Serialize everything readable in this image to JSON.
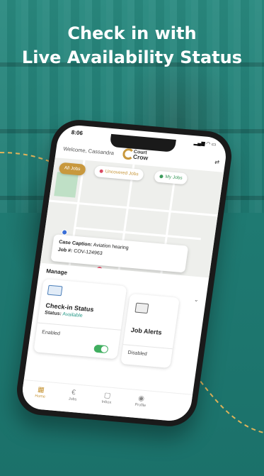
{
  "headline": {
    "line1": "Check in with",
    "line2": "Live Availability Status"
  },
  "phone": {
    "status_time": "8:06",
    "status_icons": "▂▄▆ ◠ ▭",
    "welcome": "Welcome, Cassandra",
    "logo": {
      "word1": "Court",
      "word2": "Crow"
    },
    "filters": [
      {
        "label": "All Jobs"
      },
      {
        "label": "Uncovered Jobs"
      },
      {
        "label": "My Jobs"
      }
    ],
    "case_card": {
      "caption_label": "Case Caption:",
      "caption_value": "Aviation hearing",
      "job_label": "Job #:",
      "job_value": "COV-124963"
    },
    "manage": {
      "title": "Manage",
      "checkin": {
        "title": "Check-in Status",
        "status_label": "Status:",
        "status_value": "Available",
        "toggle_label": "Enabled",
        "toggle_on": true
      },
      "alerts": {
        "title": "Job Alerts",
        "toggle_label": "Disabled"
      }
    },
    "tabs": [
      {
        "label": "Home",
        "icon": "home-icon",
        "active": true
      },
      {
        "label": "Jobs",
        "icon": "jobs-icon",
        "active": false
      },
      {
        "label": "Inbox",
        "icon": "inbox-icon",
        "active": false
      },
      {
        "label": "Profile",
        "icon": "profile-icon",
        "active": false
      }
    ]
  },
  "colors": {
    "background": "#1f7d74",
    "accent_gold": "#c8983d",
    "available_teal": "#2a9b8a",
    "toggle_green": "#3fae5f"
  }
}
